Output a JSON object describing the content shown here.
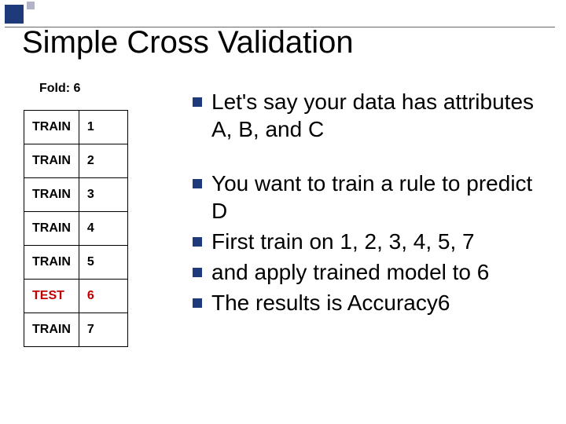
{
  "title": "Simple Cross Validation",
  "fold_label": "Fold: 6",
  "table": {
    "rows": [
      {
        "label": "TRAIN",
        "num": "1",
        "test": false
      },
      {
        "label": "TRAIN",
        "num": "2",
        "test": false
      },
      {
        "label": "TRAIN",
        "num": "3",
        "test": false
      },
      {
        "label": "TRAIN",
        "num": "4",
        "test": false
      },
      {
        "label": "TRAIN",
        "num": "5",
        "test": false
      },
      {
        "label": "TEST",
        "num": "6",
        "test": true
      },
      {
        "label": "TRAIN",
        "num": "7",
        "test": false
      }
    ]
  },
  "bullets": [
    "Let's say your data has attributes A, B, and C",
    "",
    "You want to train a rule to predict D",
    "First train on 1, 2, 3, 4, 5, 7",
    "and apply trained model to 6",
    "The results is Accuracy6"
  ]
}
